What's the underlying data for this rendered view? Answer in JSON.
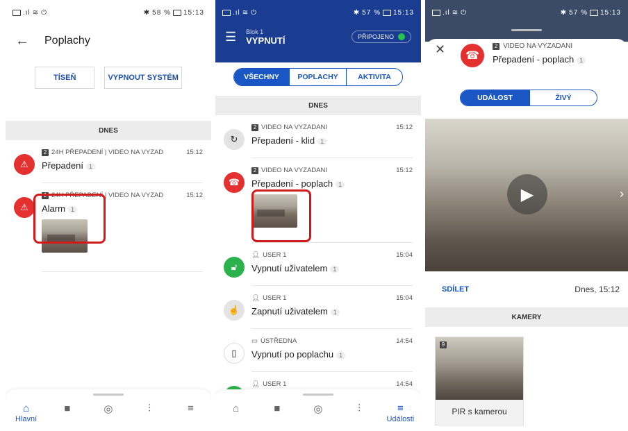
{
  "p1": {
    "status": {
      "battery": "58 %",
      "time": "15:13"
    },
    "title": "Poplachy",
    "buttons": [
      "TÍSEŇ",
      "VYPNOUT SYSTÉM"
    ],
    "section": "DNES",
    "events": [
      {
        "badge": "2",
        "source": "24H PŘEPADENÍ | VIDEO NA VYZAD",
        "time": "15:12",
        "msg": "Přepadení",
        "count": "1"
      },
      {
        "badge": "2",
        "source": "24H PŘEPADENÍ | VIDEO NA VYZAD",
        "time": "15:12",
        "msg": "Alarm",
        "count": "1"
      }
    ],
    "nav_active": "Hlavní"
  },
  "p2": {
    "status": {
      "battery": "57 %",
      "time": "15:13"
    },
    "block": "Blok 1",
    "title": "VYPNUTÍ",
    "connection": "PŘIPOJENO",
    "tabs": [
      "VŠECHNY",
      "POPLACHY",
      "AKTIVITA"
    ],
    "section": "DNES",
    "events": [
      {
        "badge": "2",
        "source": "VIDEO NA VYZADANI",
        "time": "15:12",
        "msg": "Přepadení - klid",
        "count": "1"
      },
      {
        "badge": "2",
        "source": "VIDEO NA VYZADANI",
        "time": "15:12",
        "msg": "Přepadení - poplach",
        "count": "1"
      },
      {
        "source": "USER 1",
        "time": "15:04",
        "msg": "Vypnutí uživatelem",
        "count": "1"
      },
      {
        "source": "USER 1",
        "time": "15:04",
        "msg": "Zapnutí uživatelem",
        "count": "1"
      },
      {
        "source": "ÚSTŘEDNA",
        "time": "14:54",
        "msg": "Vypnutí po poplachu",
        "count": "1"
      },
      {
        "source": "USER 1",
        "time": "14:54",
        "msg": "",
        "count": ""
      }
    ],
    "nav_active": "Události"
  },
  "p3": {
    "status": {
      "battery": "57 %",
      "time": "15:13"
    },
    "badge": "2",
    "source": "VIDEO NA VYZADANI",
    "msg": "Přepadení - poplach",
    "count": "1",
    "tabs": [
      "UDÁLOST",
      "ŽIVÝ"
    ],
    "share": "SDÍLET",
    "when": "Dnes, 15:12",
    "section": "KAMERY",
    "camera": {
      "badge": "9",
      "name": "PIR s kamerou"
    }
  },
  "colors": {
    "accent": "#1a56c4",
    "alarm": "#e53030",
    "ok": "#2bb24c",
    "header": "#1a3d91",
    "highlight": "#d21a1a"
  }
}
